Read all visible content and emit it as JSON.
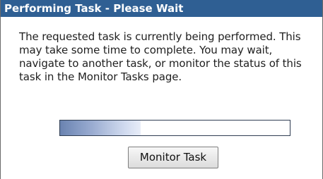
{
  "dialog": {
    "title": "Performing Task - Please Wait",
    "message": "The requested task is currently being performed. This may take some time to complete. You may wait, navigate to another task, or monitor the status of this task in the Monitor Tasks page.",
    "progress": 0.35,
    "monitor_button_label": "Monitor Task"
  },
  "colors": {
    "titlebar": "#2f5f93",
    "progress_fill": "#6a83b0"
  }
}
